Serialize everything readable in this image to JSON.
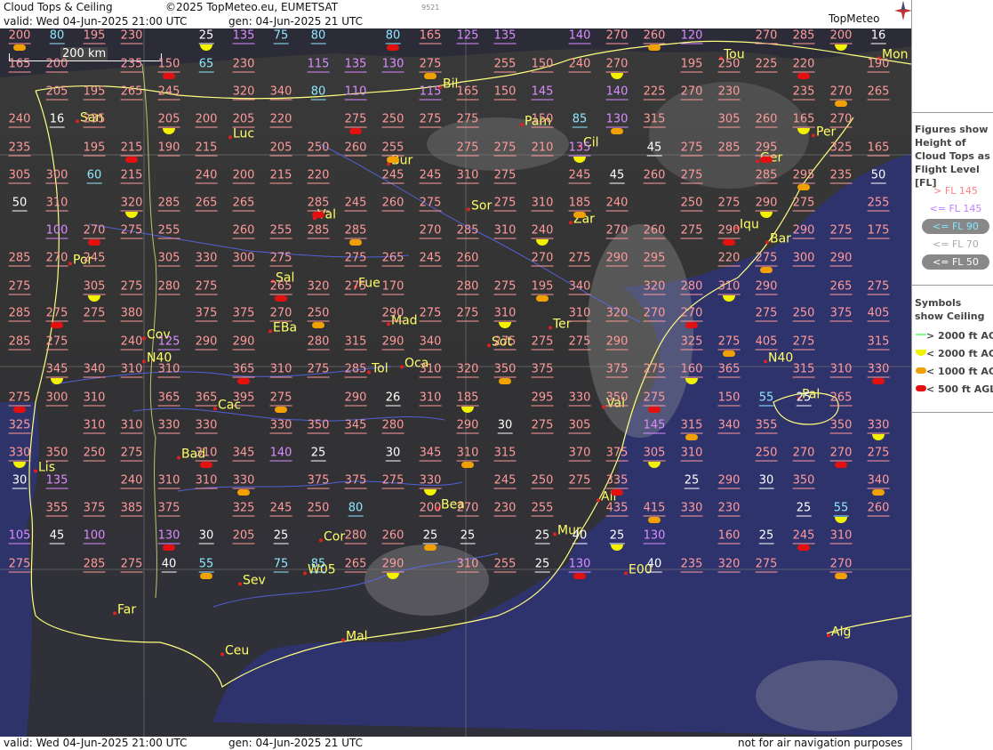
{
  "header": {
    "title": "Cloud Tops & Ceiling",
    "copyright": "©2025 TopMeteo.eu, EUMETSAT",
    "image_id": "9521",
    "valid": "valid:  Wed  04-Jun-2025  21:00 UTC",
    "generated": "gen: 04-Jun-2025 21 UTC",
    "brand": "TopMeteo"
  },
  "footer": {
    "valid": "valid:  Wed  04-Jun-2025  21:00 UTC",
    "generated": "gen: 04-Jun-2025 21 UTC",
    "disclaimer": "not for air navigation purposes"
  },
  "scale_label": "200 km",
  "legend": {
    "figures_title": "Figures show Height of Cloud Tops as Flight Level  [FL]",
    "levels": [
      {
        "label": "> FL 145",
        "color": "#ff8080"
      },
      {
        "label": "<= FL 145",
        "color": "#c080ff"
      },
      {
        "label": "<= FL 90",
        "color": "#80e8ff"
      },
      {
        "label": "<= FL 70",
        "color": "#aaaaaa"
      },
      {
        "label": "<= FL 50",
        "color": "#ffffff"
      }
    ],
    "symbols_title": "Symbols show Ceiling",
    "symbols": [
      {
        "label": "> 2000 ft AGL",
        "color": "#80ff80"
      },
      {
        "label": "< 2000 ft AGL",
        "color": "#f2f200"
      },
      {
        "label": "< 1000 ft AGL",
        "color": "#f0a000"
      },
      {
        "label": "< 500 ft AGL",
        "color": "#e31010"
      }
    ]
  },
  "cities": [
    "Tou",
    "Mon",
    "Bil",
    "Pam",
    "Per",
    "San",
    "Luc",
    "Cil",
    "Bur",
    "Ger",
    "Sor",
    "Zar",
    "Val",
    "Iqu",
    "Bar",
    "Por",
    "Sal",
    "Fue",
    "Mad",
    "Ter",
    "Cov",
    "EBa",
    "Sot",
    "Tol",
    "Oca",
    "Cac",
    "Val",
    "Pal",
    "Bad",
    "Lis",
    "Bea",
    "Ali",
    "Cor",
    "Mur",
    "Sev",
    "Far",
    "Mal",
    "Ceu",
    "Alg",
    "N40",
    "N40",
    "W05",
    "E00"
  ],
  "values": [
    "200",
    "80",
    "195",
    "230",
    "25",
    "135",
    "75",
    "80",
    "80",
    "165",
    "125",
    "135",
    "140",
    "270",
    "260",
    "120",
    "270",
    "285",
    "200",
    "16",
    "165",
    "200",
    "235",
    "150",
    "65",
    "230",
    "115",
    "135",
    "130",
    "275",
    "255",
    "150",
    "240",
    "270",
    "195",
    "250",
    "225",
    "220",
    "190",
    "205",
    "195",
    "265",
    "245",
    "320",
    "340",
    "80",
    "110",
    "115",
    "165",
    "150",
    "145",
    "140",
    "225",
    "270",
    "230",
    "235",
    "270",
    "265",
    "240",
    "16",
    "235",
    "205",
    "200",
    "205",
    "220",
    "275",
    "250",
    "275",
    "275",
    "150",
    "85",
    "130",
    "315",
    "305",
    "260",
    "165",
    "270",
    "235",
    "195",
    "215",
    "190",
    "215",
    "205",
    "250",
    "260",
    "255",
    "275",
    "275",
    "210",
    "135",
    "45",
    "275",
    "285",
    "295",
    "325",
    "165",
    "305",
    "300",
    "60",
    "215",
    "240",
    "200",
    "215",
    "220",
    "245",
    "245",
    "310",
    "275",
    "245",
    "45",
    "260",
    "275",
    "285",
    "295",
    "235",
    "50",
    "50",
    "310",
    "320",
    "285",
    "265",
    "265",
    "285",
    "245",
    "260",
    "275",
    "275",
    "310",
    "185",
    "240",
    "250",
    "275",
    "290",
    "275",
    "255",
    "100",
    "270",
    "275",
    "255",
    "260",
    "255",
    "285",
    "285",
    "270",
    "285",
    "310",
    "240",
    "270",
    "260",
    "275",
    "290",
    "290",
    "275",
    "175",
    "285",
    "270",
    "245",
    "305",
    "330",
    "300",
    "275",
    "275",
    "265",
    "245",
    "260",
    "270",
    "275",
    "290",
    "295",
    "220",
    "275",
    "300",
    "290",
    "275",
    "305",
    "275",
    "280",
    "275",
    "265",
    "320",
    "275",
    "170",
    "280",
    "275",
    "195",
    "340",
    "320",
    "280",
    "310",
    "290",
    "265",
    "275",
    "285",
    "275",
    "275",
    "380",
    "375",
    "375",
    "270",
    "250",
    "290",
    "275",
    "275",
    "310",
    "310",
    "320",
    "270",
    "270",
    "275",
    "250",
    "375",
    "405",
    "285",
    "275",
    "240",
    "125",
    "290",
    "290",
    "280",
    "315",
    "290",
    "340",
    "275",
    "275",
    "275",
    "290",
    "325",
    "275",
    "405",
    "275",
    "315",
    "345",
    "340",
    "310",
    "310",
    "365",
    "310",
    "275",
    "285",
    "310",
    "320",
    "350",
    "375",
    "375",
    "275",
    "160",
    "365",
    "315",
    "310",
    "330",
    "275",
    "300",
    "310",
    "365",
    "365",
    "395",
    "275",
    "290",
    "26",
    "310",
    "185",
    "295",
    "330",
    "350",
    "275",
    "150",
    "55",
    "25",
    "265",
    "325",
    "310",
    "310",
    "330",
    "330",
    "330",
    "350",
    "345",
    "280",
    "290",
    "30",
    "275",
    "305",
    "145",
    "315",
    "340",
    "355",
    "350",
    "330",
    "330",
    "350",
    "250",
    "275",
    "310",
    "345",
    "140",
    "25",
    "30",
    "345",
    "310",
    "315",
    "370",
    "375",
    "305",
    "310",
    "250",
    "270",
    "270",
    "275",
    "30",
    "135",
    "240",
    "310",
    "310",
    "330",
    "375",
    "375",
    "275",
    "330",
    "245",
    "250",
    "275",
    "335",
    "25",
    "290",
    "30",
    "350",
    "340",
    "355",
    "375",
    "385",
    "375",
    "325",
    "245",
    "250",
    "80",
    "200",
    "270",
    "230",
    "255",
    "435",
    "415",
    "330",
    "230",
    "25",
    "55",
    "260",
    "105",
    "45",
    "100",
    "130",
    "30",
    "205",
    "25",
    "280",
    "260",
    "25",
    "25",
    "25",
    "40",
    "25",
    "130",
    "160",
    "25",
    "245",
    "310",
    "275",
    "285",
    "275",
    "40",
    "55",
    "75",
    "85",
    "265",
    "290",
    "310",
    "255",
    "25",
    "130",
    "40",
    "235",
    "320",
    "275",
    "270"
  ]
}
